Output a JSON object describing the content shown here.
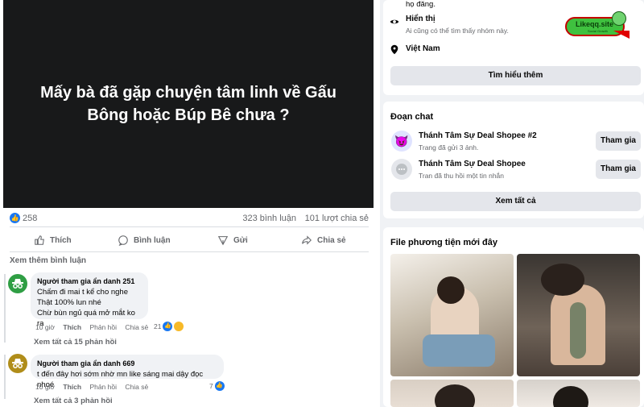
{
  "post": {
    "video_title_line1": "Mấy bà đã gặp chuyện tâm linh về Gấu",
    "video_title_line2": "Bông hoặc Búp Bê chưa ?",
    "likes": "258",
    "comments": "323 bình luận",
    "shares": "101 lượt chia sẻ",
    "actions": {
      "like": "Thích",
      "comment": "Bình luận",
      "send": "Gửi",
      "share": "Chia sẻ"
    },
    "more_comments": "Xem thêm bình luận"
  },
  "comments": [
    {
      "author": "Người tham gia ẩn danh 251",
      "lines": [
        "Chấm đi mai t kể cho nghe",
        "Thật 100% lun nhé",
        "Chừ bùn ngủ quá mở mắt ko ra"
      ],
      "time": "10 giờ",
      "like": "Thích",
      "reply": "Phản hồi",
      "share": "Chia sẻ",
      "reactions": "21",
      "view_replies": "Xem tất cả 15 phản hồi",
      "avatar_color": "#2f9e44"
    },
    {
      "author": "Người tham gia ẩn danh 669",
      "lines": [
        "t đến đây hơi sớm nhờ mn like sáng mai dậy đọc nhoé"
      ],
      "time": "10 giờ",
      "like": "Thích",
      "reply": "Phản hồi",
      "share": "Chia sẻ",
      "reactions": "7",
      "view_replies": "Xem tất cả 3 phản hồi",
      "avatar_color": "#b08d1a"
    }
  ],
  "about": {
    "top_text": "họ đăng.",
    "visible_title": "Hiển thị",
    "visible_desc": "Ai cũng có thể tìm thấy nhóm này.",
    "location": "Việt Nam",
    "learn_more": "Tìm hiểu thêm",
    "logo_text": "Likeqq.site",
    "logo_sub": "Social Growth"
  },
  "chats": {
    "title": "Đoạn chat",
    "items": [
      {
        "name": "Thánh Tâm Sự Deal Shopee #2",
        "sub": "Trang đã gửi 3 ảnh.",
        "button": "Tham gia"
      },
      {
        "name": "Thánh Tâm Sự Deal Shopee",
        "sub": "Tran đã thu hồi một tin nhắn",
        "button": "Tham gia"
      }
    ],
    "see_all": "Xem tất cả"
  },
  "media": {
    "title": "File phương tiện mới đây"
  }
}
